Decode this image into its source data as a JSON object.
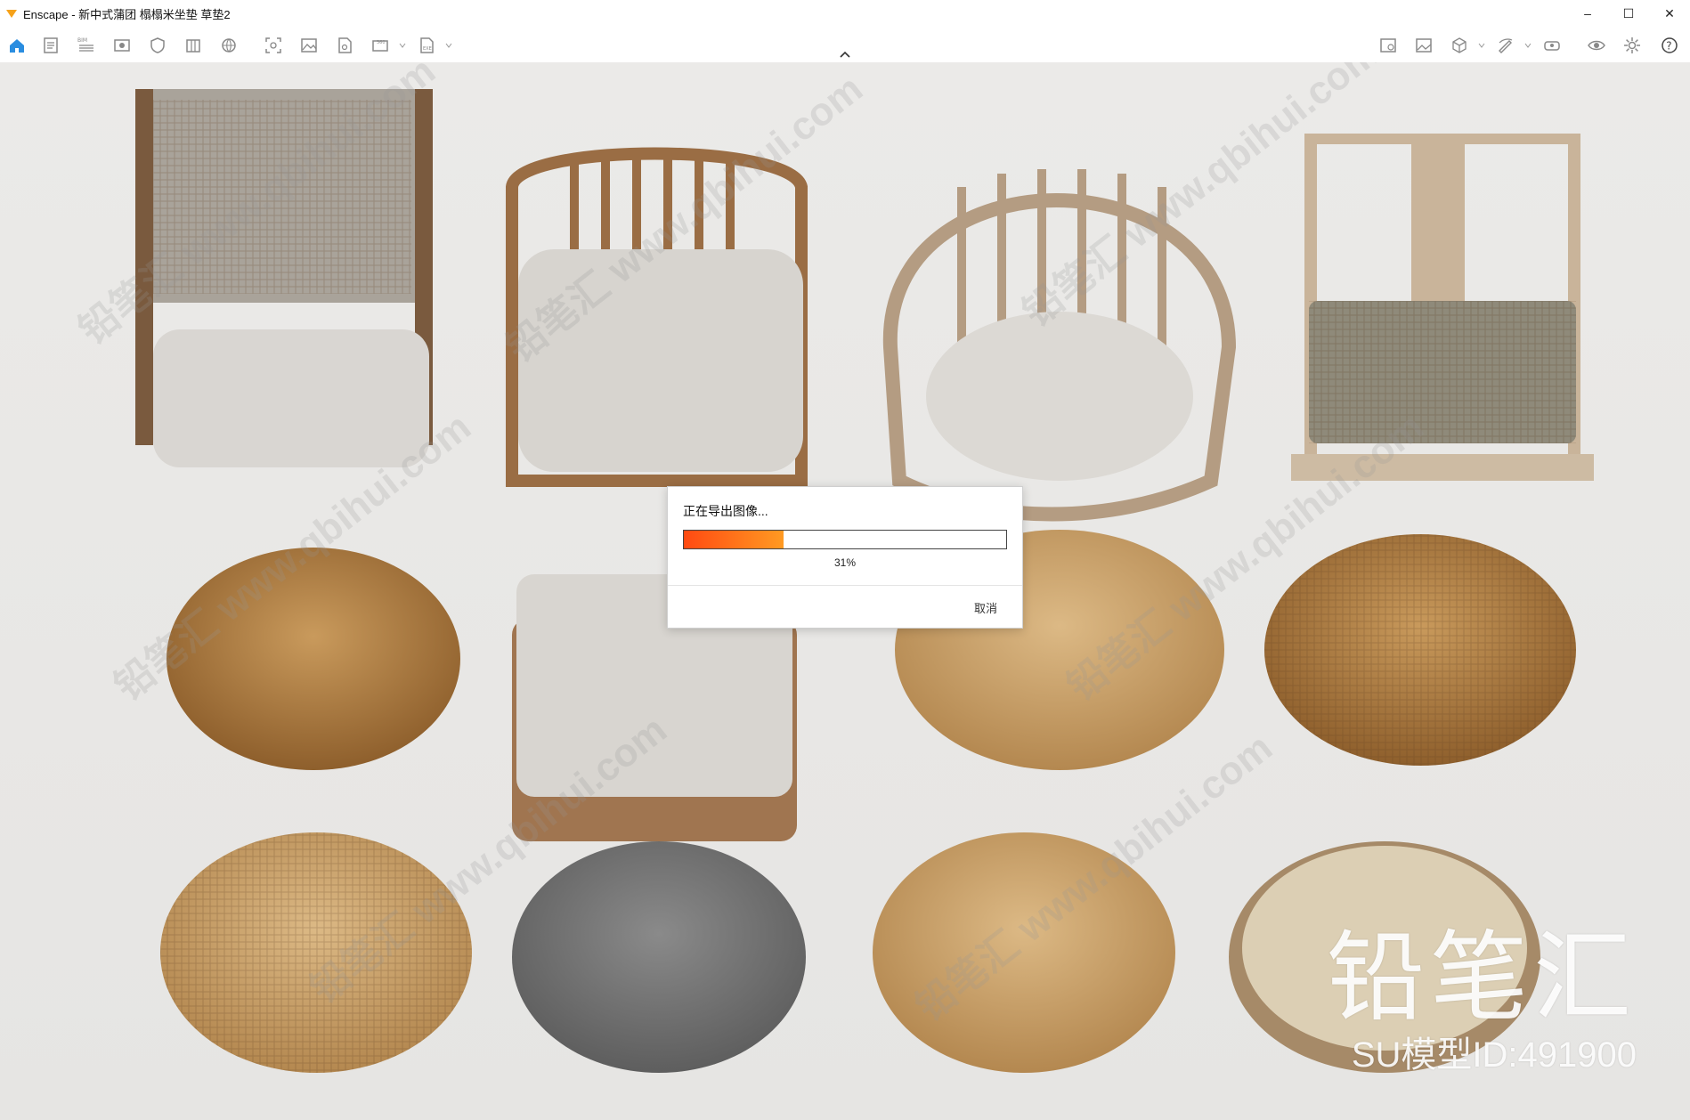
{
  "window": {
    "title": "Enscape - 新中式蒲团 榻榻米坐垫 草垫2",
    "controls": {
      "minimize": "–",
      "maximize": "☐",
      "close": "✕"
    }
  },
  "toolbar": {
    "left_icons": [
      "home-icon",
      "document-icon",
      "bim-icon",
      "eye-view-icon",
      "shield-icon",
      "library-icon",
      "globe-icon",
      "screenshot-icon",
      "image-icon",
      "export-file-icon",
      "panorama-360-icon",
      "exe-export-icon"
    ],
    "right_icons": [
      "map-icon",
      "picture-icon",
      "cube-icon",
      "paint-icon",
      "vr-headset-icon",
      "visibility-icon",
      "settings-icon",
      "help-icon"
    ],
    "help_label": "?"
  },
  "viewport": {
    "watermark": "铅笔汇 www.qbihui.com",
    "brand": "铅笔汇",
    "model_id": "SU模型ID:491900"
  },
  "dialog": {
    "title": "正在导出图像...",
    "progress": 0.31,
    "percent_label": "31%",
    "cancel_label": "取消",
    "accent_start": "#ff4a12",
    "accent_end": "#ff9a22"
  }
}
